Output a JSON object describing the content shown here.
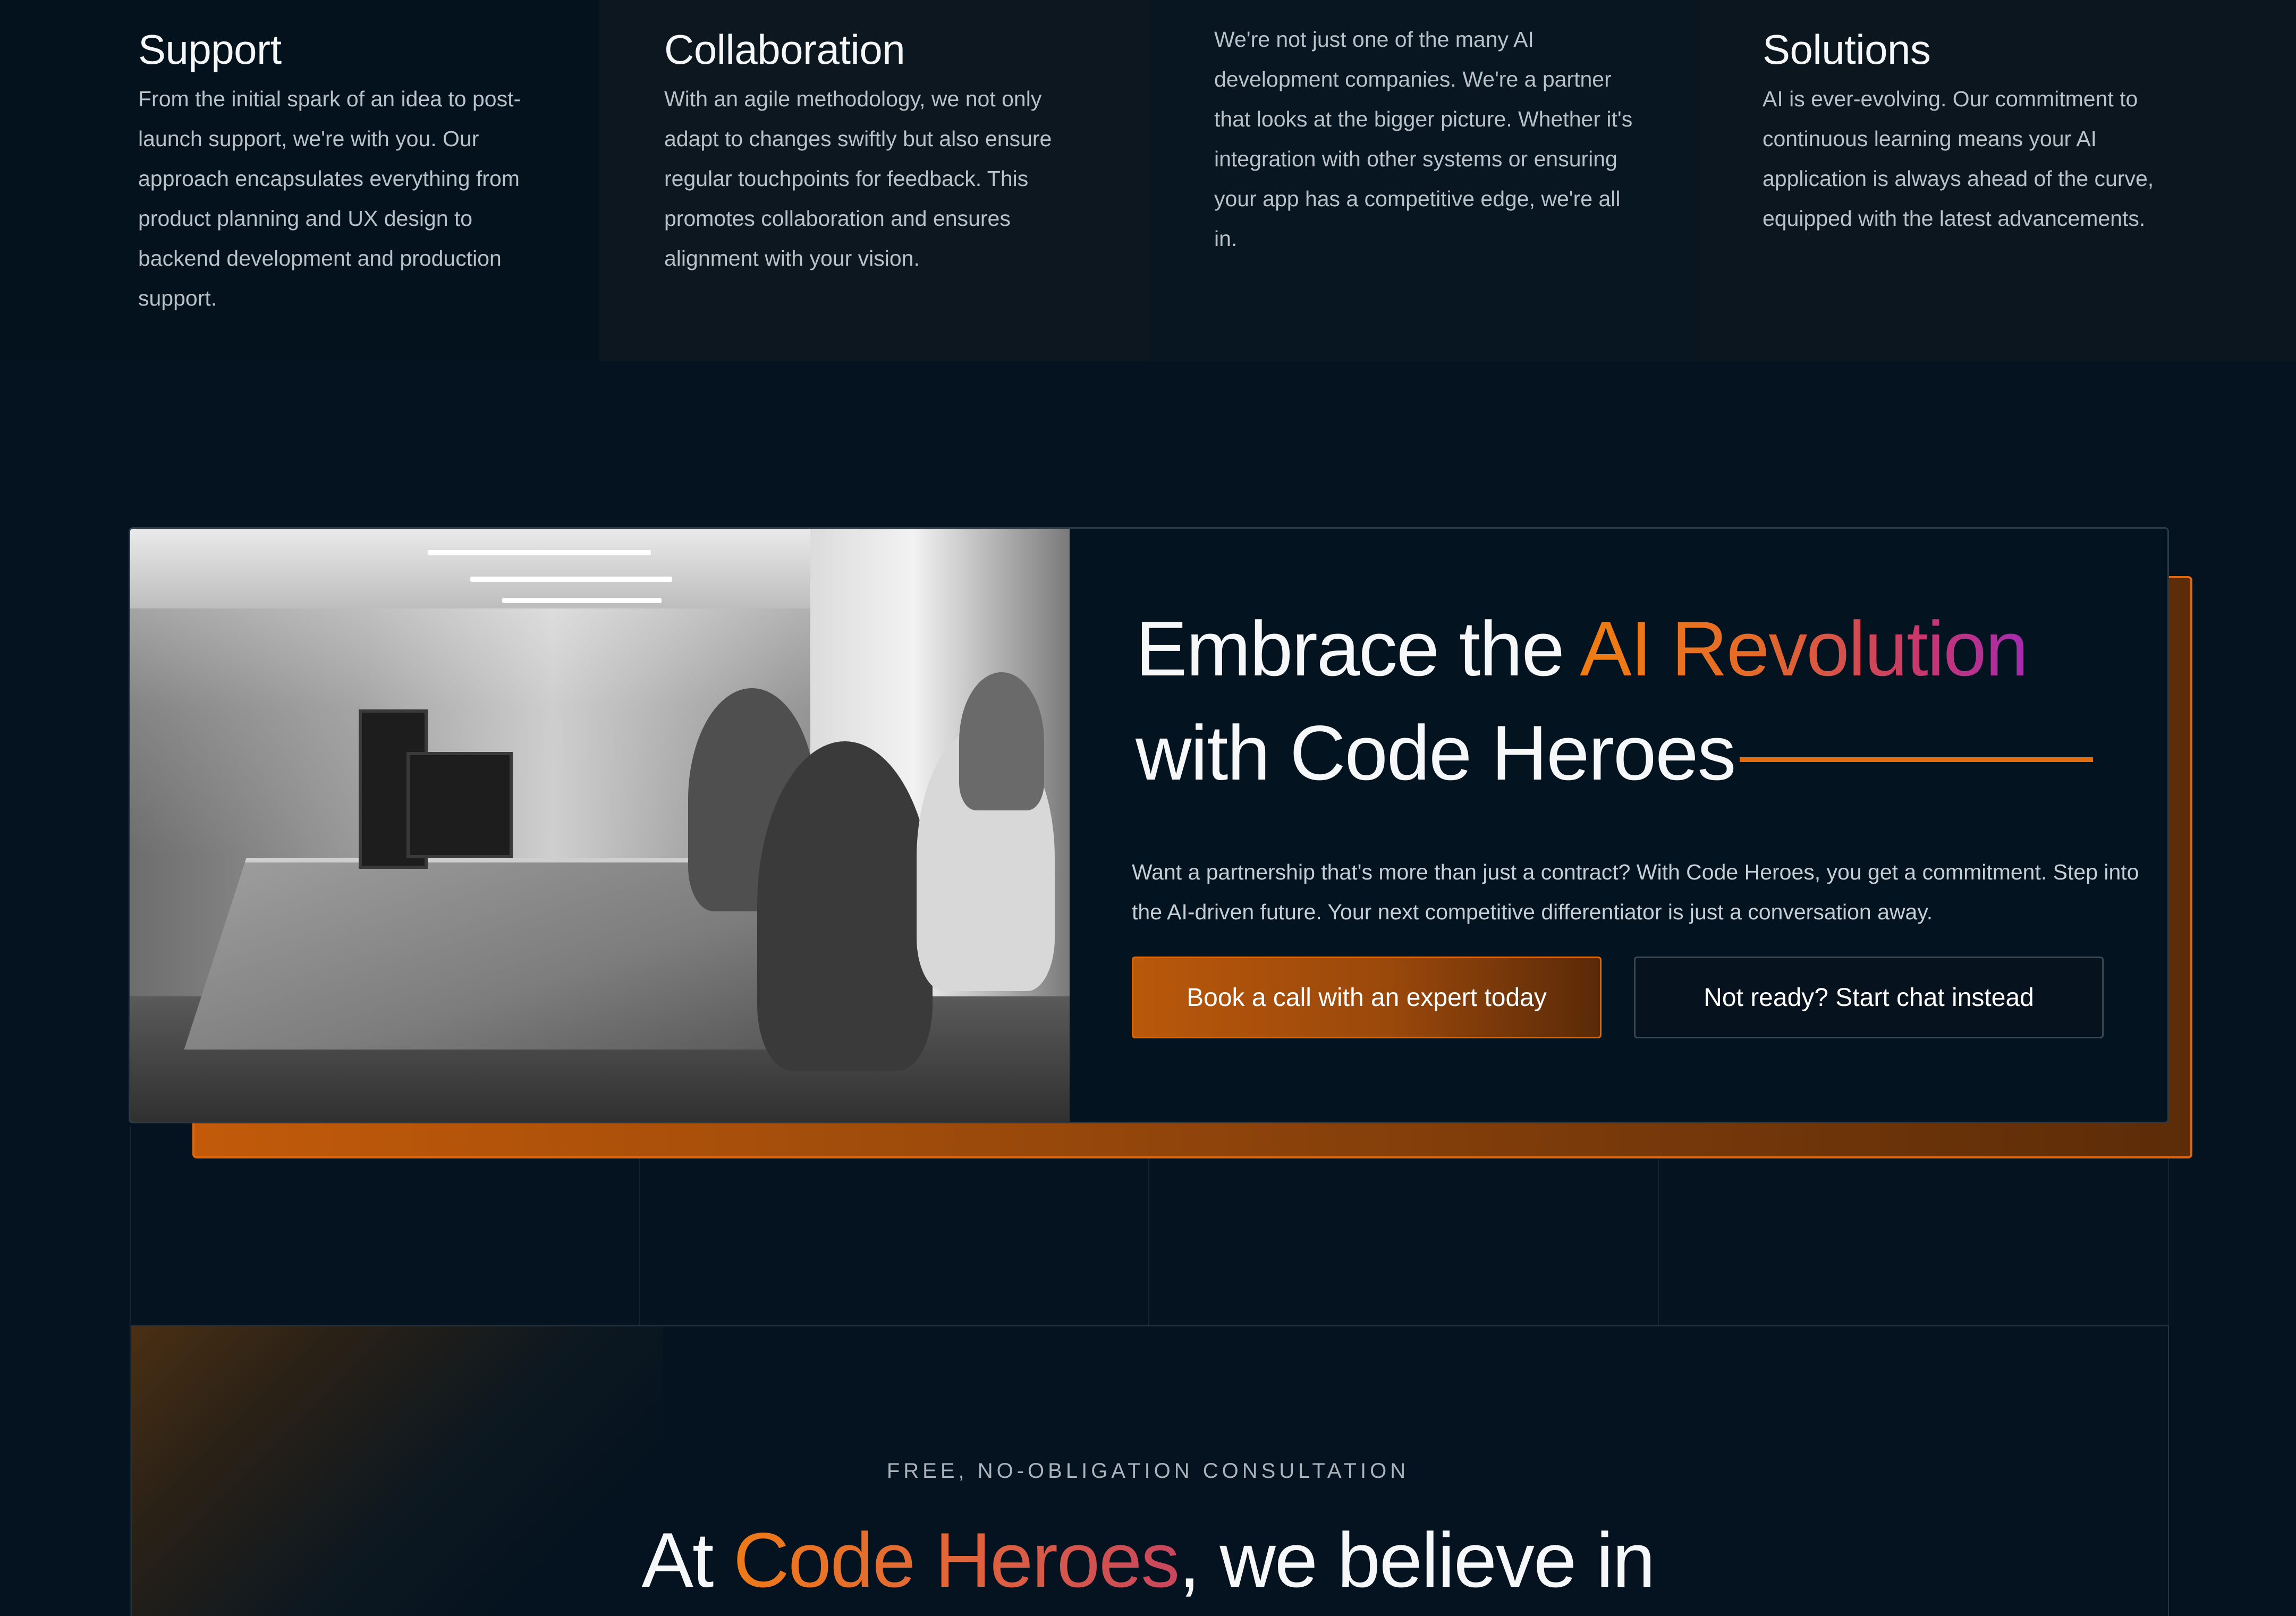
{
  "features": [
    {
      "title": "Support",
      "text": "From the initial spark of an idea to post-launch support, we're with you. Our approach encapsulates everything from product planning and UX design to backend development and production support."
    },
    {
      "title": "Collaboration",
      "text": "With an agile methodology, we not only adapt to changes swiftly but also ensure regular touchpoints for feedback. This promotes collaboration and ensures alignment with your vision."
    },
    {
      "title": "",
      "text": "We're not just one of the many AI development companies. We're a partner that looks at the bigger picture. Whether it's integration with other systems or ensuring your app has a competitive edge, we're all in."
    },
    {
      "title": "Solutions",
      "text": "AI is ever-evolving. Our commitment to continuous learning means your AI application is always ahead of the curve, equipped with the latest advancements."
    }
  ],
  "cta": {
    "title_part1": "Embrace the ",
    "title_highlight": "AI Revolution",
    "title_part2": "with Code Heroes",
    "description": "Want a partnership that's more than just a contract? With Code Heroes, you get a commitment. Step into the AI-driven future. Your next competitive differentiator is just a conversation away.",
    "primary_button": "Book a call with an expert today",
    "secondary_button": "Not ready? Start chat instead"
  },
  "consultation": {
    "eyebrow": "FREE, NO-OBLIGATION CONSULTATION",
    "heading_prefix": "At ",
    "heading_highlight": "Code Heroes",
    "heading_suffix": ", we believe in"
  },
  "colors": {
    "background": "#04131f",
    "accent_orange": "#e56f10",
    "accent_purple": "#a52bb0"
  }
}
